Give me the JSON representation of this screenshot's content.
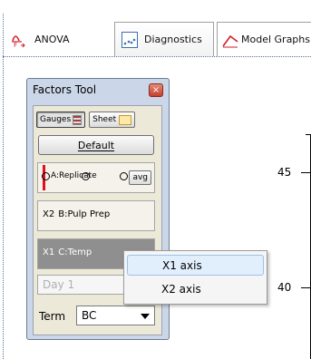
{
  "tabs": [
    {
      "label": "ANOVA",
      "icon": "f-test-icon"
    },
    {
      "label": "Diagnostics",
      "icon": "scatter-plot-icon"
    },
    {
      "label": "Model Graphs",
      "icon": "line-graph-icon"
    }
  ],
  "factors_tool": {
    "title": "Factors Tool",
    "close_glyph": "×",
    "view_gauges_label": "Gauges",
    "view_sheet_label": "Sheet",
    "default_button": "Default",
    "factors": [
      {
        "axis": "",
        "name": "A:Replicate",
        "avg_label": "avg"
      },
      {
        "axis": "X2",
        "name": "B:Pulp Prep"
      },
      {
        "axis": "X1",
        "name": "C:Temp"
      }
    ],
    "level_value": "Day 1",
    "term_label": "Term",
    "term_value": "BC"
  },
  "context_menu": {
    "items": [
      "X1 axis",
      "X2 axis"
    ]
  },
  "chart": {
    "ticks": [
      "45",
      "40"
    ]
  },
  "colors": {
    "selected_factor_bg": "#8f8f8f",
    "gauge_marker": "#e0101c",
    "menu_highlight": "#e1eefc"
  }
}
